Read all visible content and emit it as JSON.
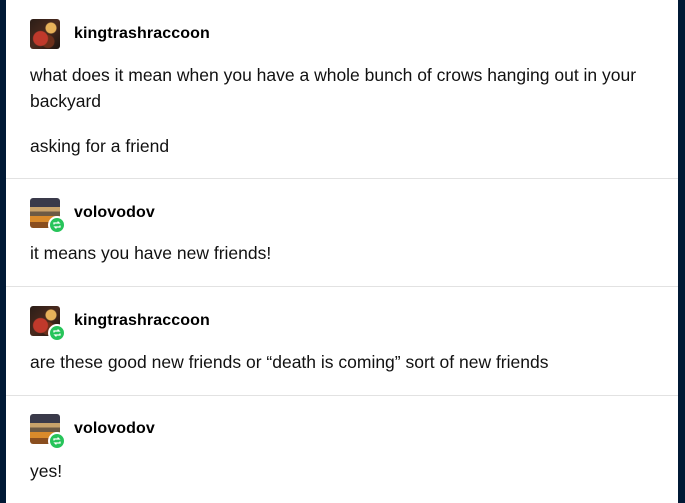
{
  "posts": [
    {
      "username": "kingtrashraccoon",
      "avatar": "raccoon-avatar",
      "reblog": false,
      "paragraphs": [
        "what does it mean when you have a whole bunch of crows hanging out in your backyard",
        "asking for a friend"
      ]
    },
    {
      "username": "volovodov",
      "avatar": "crow-avatar",
      "reblog": true,
      "paragraphs": [
        "it means you have new friends!"
      ]
    },
    {
      "username": "kingtrashraccoon",
      "avatar": "raccoon-avatar",
      "reblog": true,
      "paragraphs": [
        "are these good new friends or “death is coming” sort of new friends"
      ]
    },
    {
      "username": "volovodov",
      "avatar": "crow-avatar",
      "reblog": true,
      "paragraphs": [
        "yes!"
      ]
    }
  ],
  "colors": {
    "background": "#001935",
    "card": "#ffffff",
    "reblog_badge": "#27c45a",
    "divider": "#e2e2e2"
  }
}
